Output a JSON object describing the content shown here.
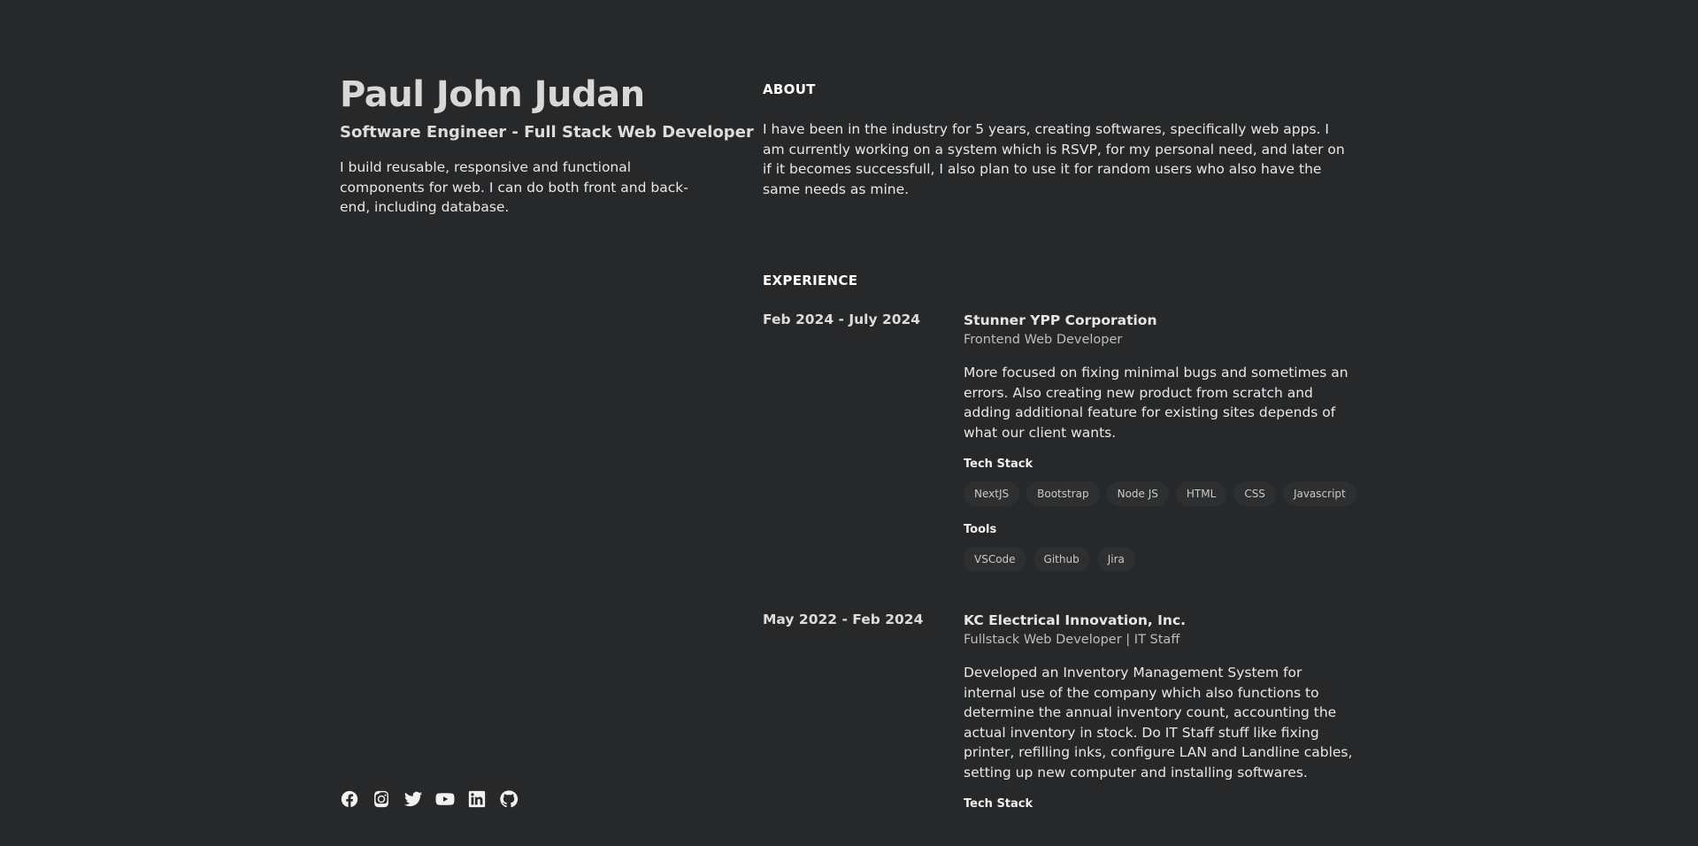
{
  "profile": {
    "name": "Paul John Judan",
    "role": "Software Engineer - Full Stack Web Developer",
    "intro": "I build reusable, responsive and functional components for web. I can do both front and back-end, including database."
  },
  "socials": [
    {
      "icon": "facebook-icon"
    },
    {
      "icon": "instagram-icon"
    },
    {
      "icon": "twitter-icon"
    },
    {
      "icon": "youtube-icon"
    },
    {
      "icon": "linkedin-icon"
    },
    {
      "icon": "github-icon"
    }
  ],
  "about": {
    "heading": "ABOUT",
    "text": "I have been in the industry for 5 years, creating softwares, specifically web apps. I am currently working on a system which is RSVP, for my personal need, and later on if it becomes successfull, I also plan to use it for random users who also have the same needs as mine."
  },
  "experience": {
    "heading": "EXPERIENCE",
    "jobs": [
      {
        "dates": "Feb 2024 - July 2024",
        "company": "Stunner YPP Corporation",
        "position": "Frontend Web Developer",
        "description": "More focused on fixing minimal bugs and sometimes an errors. Also creating new product from scratch and adding additional feature for existing sites depends of what our client wants.",
        "tech_label": "Tech Stack",
        "tech": [
          "NextJS",
          "Bootstrap",
          "Node JS",
          "HTML",
          "CSS",
          "Javascript"
        ],
        "tools_label": "Tools",
        "tools": [
          "VSCode",
          "Github",
          "Jira"
        ]
      },
      {
        "dates": "May 2022 - Feb 2024",
        "company": "KC Electrical Innovation, Inc.",
        "position": "Fullstack Web Developer | IT Staff",
        "description": "Developed an Inventory Management System for internal use of the company which also functions to determine the annual inventory count, accounting the actual inventory in stock. Do IT Staff stuff like fixing printer, refilling inks, configure LAN and Landline cables, setting up new computer and installing softwares.",
        "tech_label": "Tech Stack"
      }
    ]
  }
}
